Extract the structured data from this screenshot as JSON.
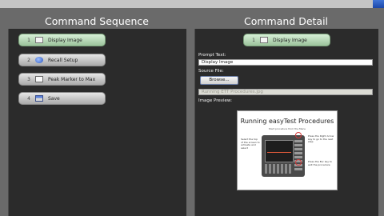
{
  "left": {
    "title": "Command Sequence",
    "steps": [
      {
        "number": "1",
        "label": "Display Image",
        "icon": "image-icon",
        "active": true
      },
      {
        "number": "2",
        "label": "Recall Setup",
        "icon": "recall-setup-icon",
        "active": false
      },
      {
        "number": "3",
        "label": "Peak Marker to Max",
        "icon": "marker-icon",
        "active": false
      },
      {
        "number": "4",
        "label": "Save",
        "icon": "save-icon",
        "active": false
      }
    ]
  },
  "right": {
    "title": "Command Detail",
    "command": {
      "number": "1",
      "label": "Display Image"
    },
    "prompt_text_label": "Prompt Text:",
    "prompt_text_value": "Display Image",
    "source_file_label": "Source File:",
    "browse_label": "Browse...",
    "source_file_value": "Running ETT Procedures.jpg",
    "image_preview_label": "Image Preview:",
    "preview": {
      "title": "Running easyTest Procedures",
      "subtitle": "Start procedure from the Menu",
      "note_left": "Select the top of the screen to activate and select",
      "note_right_top": "Press the Right Arrow key to go to the next step",
      "note_right_bottom": "Press the Esc key to exit the procedure"
    }
  },
  "colors": {
    "background": "#6a6a6a",
    "panel": "#2b2b2b",
    "active_step": "#b8dcb8",
    "step": "#cfcfcf"
  }
}
